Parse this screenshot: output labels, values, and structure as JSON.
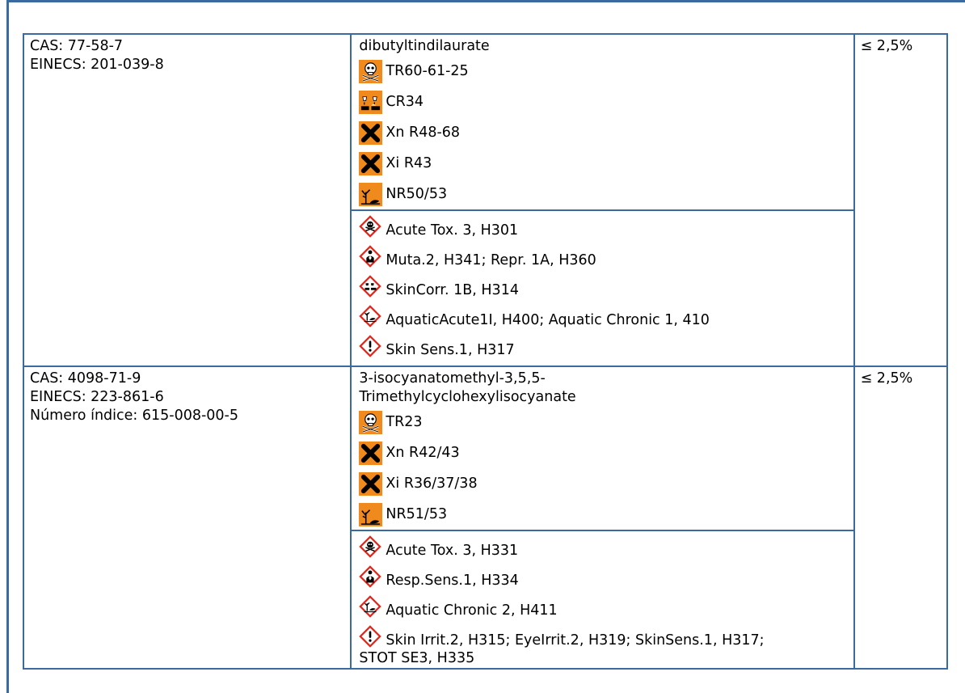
{
  "substances": [
    {
      "cas": "CAS: 77-58-7",
      "einecs": "EINECS: 201-039-8",
      "indice": "",
      "name_lines": [
        "dibutyltindilaurate"
      ],
      "dsd": [
        {
          "icon": "toxic-skull-orange-icon",
          "text": "TR60-61-25"
        },
        {
          "icon": "corrosive-orange-icon",
          "text": "CR34"
        },
        {
          "icon": "harmful-x-orange-icon",
          "text": "Xn R48-68"
        },
        {
          "icon": "irritant-x-orange-icon",
          "text": "Xi R43"
        },
        {
          "icon": "environment-orange-icon",
          "text": "NR50/53"
        }
      ],
      "clp": [
        {
          "icon": "ghs-skull-icon",
          "text": "Acute Tox. 3, H301"
        },
        {
          "icon": "ghs-health-hazard-icon",
          "text": "Muta.2, H341; Repr. 1A, H360"
        },
        {
          "icon": "ghs-corrosion-icon",
          "text": "SkinCorr. 1B, H314"
        },
        {
          "icon": "ghs-environment-icon",
          "text": "AquaticAcute1I, H400; Aquatic Chronic 1, 410"
        },
        {
          "icon": "ghs-exclamation-icon",
          "text": "Skin Sens.1, H317"
        }
      ],
      "percent": "≤ 2,5%"
    },
    {
      "cas": "CAS: 4098-71-9",
      "einecs": "EINECS: 223-861-6",
      "indice": "Número índice: 615-008-00-5",
      "name_lines": [
        "3-isocyanatomethyl-3,5,5-",
        "Trimethylcyclohexylisocyanate"
      ],
      "dsd": [
        {
          "icon": "toxic-skull-orange-icon",
          "text": "TR23"
        },
        {
          "icon": "harmful-x-orange-icon",
          "text": "Xn R42/43"
        },
        {
          "icon": "irritant-x-orange-icon",
          "text": "Xi R36/37/38"
        },
        {
          "icon": "environment-orange-icon",
          "text": "NR51/53"
        }
      ],
      "clp": [
        {
          "icon": "ghs-skull-icon",
          "text": "Acute Tox. 3, H331"
        },
        {
          "icon": "ghs-health-hazard-icon",
          "text": "Resp.Sens.1, H334"
        },
        {
          "icon": "ghs-environment-icon",
          "text": "Aquatic Chronic 2, H411"
        },
        {
          "icon": "ghs-exclamation-icon",
          "text": "Skin Irrit.2, H315; EyeIrrit.2, H319; SkinSens.1, H317;"
        }
      ],
      "clp_extra": "STOT  SE3, H335",
      "percent": "≤ 2,5%"
    }
  ]
}
